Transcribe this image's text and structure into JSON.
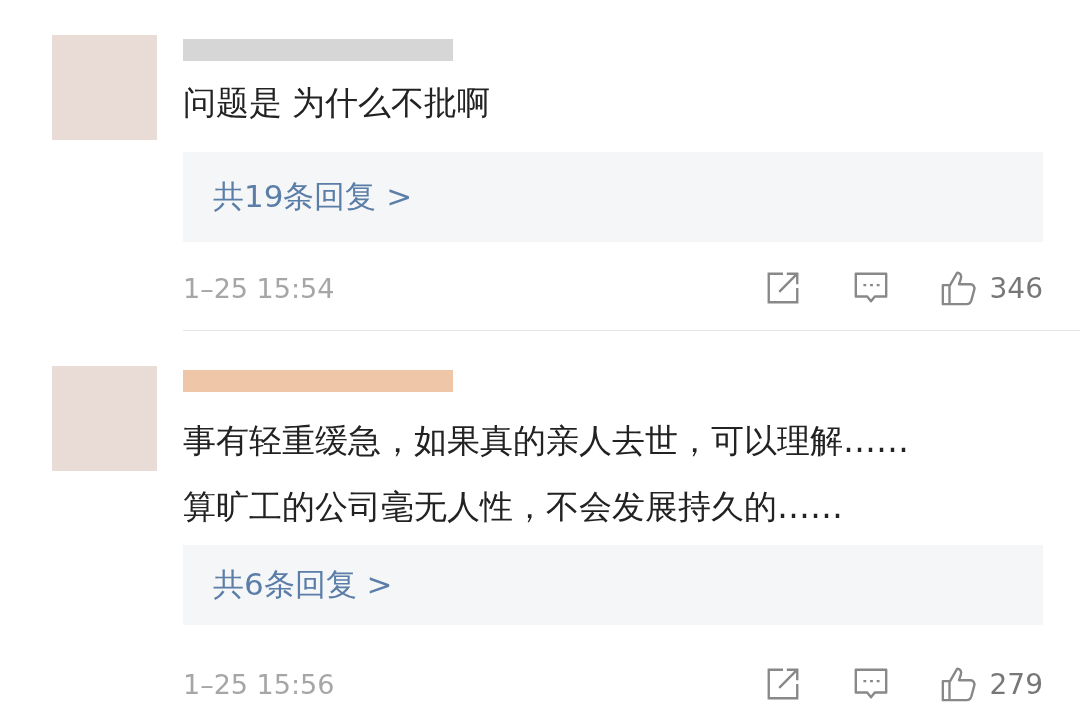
{
  "comments": [
    {
      "text_lines": [
        "问题是 为什么不批啊"
      ],
      "replies_link": "共19条回复 >",
      "time": "1–25 15:54",
      "likes": "346"
    },
    {
      "text_lines": [
        "事有轻重缓急，如果真的亲人去世，可以理解……",
        "算旷工的公司毫无人性，不会发展持久的……"
      ],
      "replies_link": "共6条回复 >",
      "time": "1–25 15:56",
      "likes": "279"
    }
  ]
}
